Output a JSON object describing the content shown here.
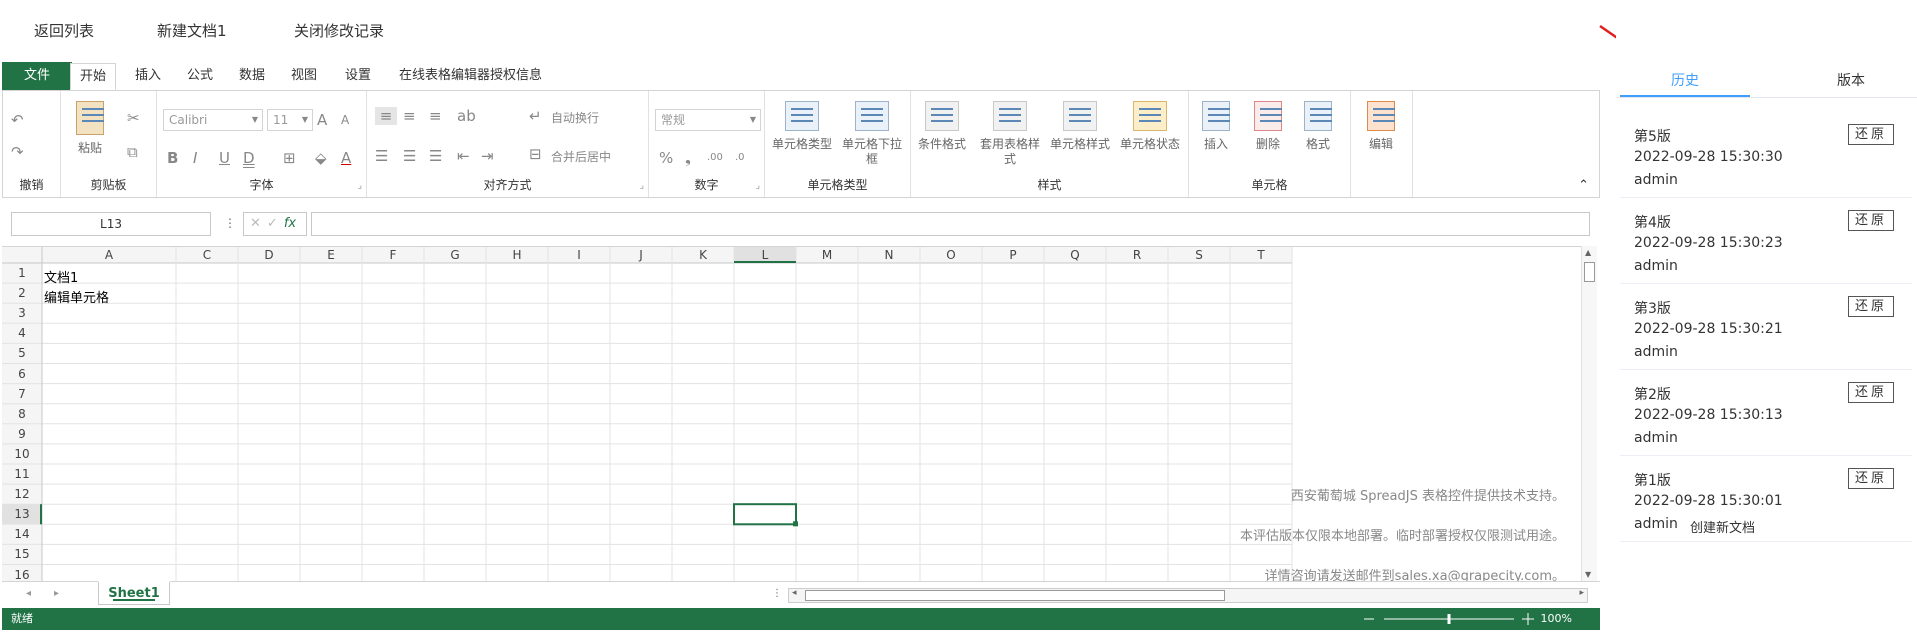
{
  "topnav": {
    "back": "返回列表",
    "new_doc": "新建文档1",
    "close_log": "关闭修改记录"
  },
  "ribbon": {
    "tabs": [
      "文件",
      "开始",
      "插入",
      "公式",
      "数据",
      "视图",
      "设置",
      "在线表格编辑器授权信息"
    ],
    "active_tab": "开始",
    "groups": {
      "undo": "撤销",
      "clipboard": "剪贴板",
      "font": "字体",
      "align": "对齐方式",
      "number": "数字",
      "celltype": "单元格类型",
      "style": "样式",
      "cells": "单元格"
    },
    "paste": "粘贴",
    "font_name": "Calibri",
    "font_size": "11",
    "wrap_text": "自动换行",
    "merge_center": "合并后居中",
    "number_format": "常规",
    "celltype_btn": "单元格类型",
    "celltype_dropdown": "单元格下拉框",
    "cond_format": "条件格式",
    "table_style": "套用表格样式",
    "cell_style": "单元格样式",
    "cell_state": "单元格状态",
    "insert": "插入",
    "delete": "删除",
    "format": "格式",
    "edit": "编辑"
  },
  "formula": {
    "name_box": "L13",
    "fx": "fx"
  },
  "grid": {
    "columns": [
      "A",
      "C",
      "D",
      "E",
      "F",
      "G",
      "H",
      "I",
      "J",
      "K",
      "L",
      "M",
      "N",
      "O",
      "P",
      "Q",
      "R",
      "S",
      "T"
    ],
    "rows": [
      "1",
      "2",
      "3",
      "4",
      "5",
      "6",
      "7",
      "8",
      "9",
      "10",
      "11",
      "12",
      "13",
      "14",
      "15",
      "16"
    ],
    "a1": "文档1",
    "a2": "编辑单元格",
    "selected_col": "L",
    "selected_row": "13"
  },
  "watermark": [
    "西安葡萄城 SpreadJS 表格控件提供技术支持。",
    "本评估版本仅限本地部署。临时部署授权仅限测试用途。",
    "详情咨询请发送邮件到sales.xa@grapecity.com。"
  ],
  "sheet": {
    "name": "Sheet1"
  },
  "status": {
    "ready": "就绪",
    "zoom": "100%",
    "zoom_pct": 100
  },
  "panel": {
    "tabs": [
      "历史",
      "版本"
    ],
    "active_tab": "历史",
    "restore_label": "还原",
    "versions": [
      {
        "title": "第5版",
        "time": "2022-09-28 15:30:30",
        "user": "admin",
        "note": ""
      },
      {
        "title": "第4版",
        "time": "2022-09-28 15:30:23",
        "user": "admin",
        "note": ""
      },
      {
        "title": "第3版",
        "time": "2022-09-28 15:30:21",
        "user": "admin",
        "note": ""
      },
      {
        "title": "第2版",
        "time": "2022-09-28 15:30:13",
        "user": "admin",
        "note": ""
      },
      {
        "title": "第1版",
        "time": "2022-09-28 15:30:01",
        "user": "admin",
        "note": "创建新文档"
      }
    ]
  },
  "colors": {
    "excel_green": "#217346",
    "accent_blue": "#409eff",
    "arrow_red": "#e02020"
  }
}
